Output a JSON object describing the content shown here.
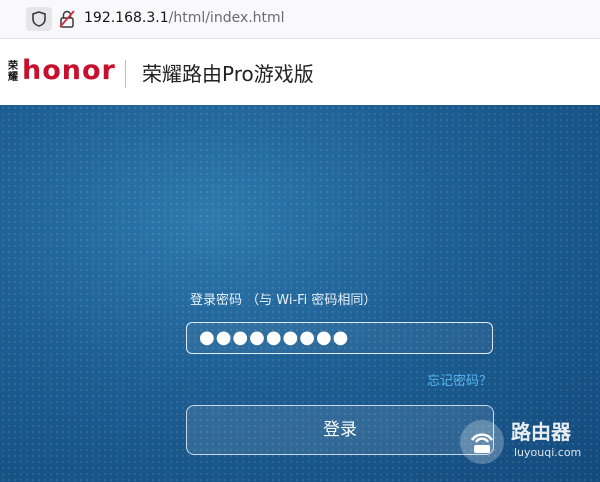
{
  "browser": {
    "url_host": "192.168.3.1",
    "url_path": "/html/index.html"
  },
  "header": {
    "logo_cn": "荣耀",
    "logo_en": "honor",
    "product_name": "荣耀路由Pro游戏版"
  },
  "login": {
    "password_label": "登录密码 （与 Wi-Fi 密码相同）",
    "password_value": "●●●●●●●●●",
    "forgot_link": "忘记密码？",
    "login_button": "登录"
  },
  "watermark": {
    "name": "路由器",
    "url": "luyouqi.com"
  },
  "colors": {
    "hero_bg": "#1d5e93",
    "link": "#57b7f0",
    "brand_red": "#c8102e"
  }
}
